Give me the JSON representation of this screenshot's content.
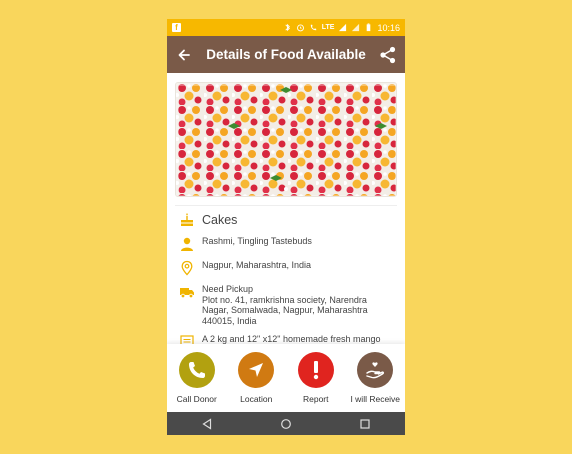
{
  "status_bar": {
    "time": "10:16",
    "network_label": "LTE"
  },
  "app_bar": {
    "title": "Details of Food Available"
  },
  "food": {
    "category": "Cakes",
    "donor": "Rashmi, Tingling  Tastebuds",
    "city": "Nagpur, Maharashtra, India",
    "pickup_title": "Need Pickup",
    "pickup_address": "Plot no. 41, ramkrishna society, Narendra Nagar, Somalwada, Nagpur, Maharashtra 440015, India",
    "description": "A 2 kg and 12\" x12\" homemade fresh mango"
  },
  "actions": [
    {
      "label": "Call Donor",
      "color": "#b2a110"
    },
    {
      "label": "Location",
      "color": "#d07a12"
    },
    {
      "label": "Report",
      "color": "#e0241f"
    },
    {
      "label": "I will Receive",
      "color": "#7a5a48"
    }
  ],
  "colors": {
    "status_bar": "#f7b800",
    "app_bar": "#7a5a48",
    "background": "#f9d65c",
    "icon_accent": "#f0b400"
  }
}
